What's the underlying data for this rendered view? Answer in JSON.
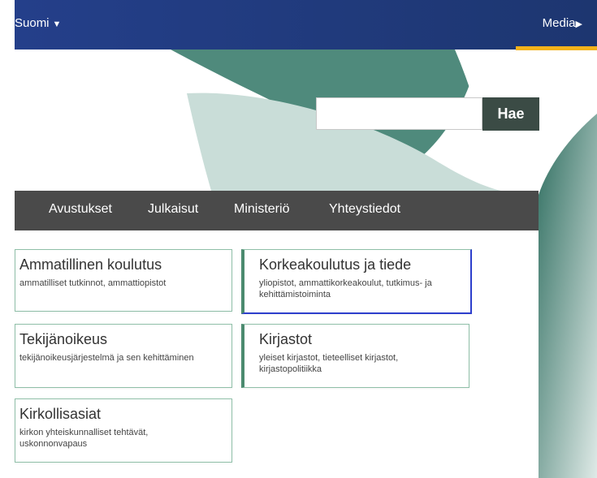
{
  "header": {
    "language": "Suomi",
    "media": "Media"
  },
  "search": {
    "placeholder": "",
    "button_label": "Hae"
  },
  "nav": {
    "items": [
      "Avustukset",
      "Julkaisut",
      "Ministeriö",
      "Yhteystiedot"
    ]
  },
  "cards": [
    {
      "title": "Ammatillinen koulutus",
      "desc": "ammatilliset tutkinnot, ammattiopistot"
    },
    {
      "title": "Korkeakoulutus ja tiede",
      "desc": "yliopistot, ammattikorkeakoulut, tutkimus- ja kehittämistoiminta"
    },
    {
      "title": "Tekijänoikeus",
      "desc": "tekijänoikeusjärjestelmä ja sen kehittäminen"
    },
    {
      "title": "Kirjastot",
      "desc": "yleiset kirjastot, tieteelliset kirjastot, kirjastopolitiikka"
    },
    {
      "title": "Kirkollisasiat",
      "desc": "kirkon yhteiskunnalliset tehtävät, uskonnonvapaus"
    }
  ],
  "colors": {
    "header": "#243f8a",
    "accent": "#f3b21a",
    "nav": "#4a4a4a",
    "leaf_dark": "#4f8a7c",
    "leaf_light": "#c9ddd8",
    "card_border": "#8fbfa8",
    "focus": "#2d3ecc"
  }
}
